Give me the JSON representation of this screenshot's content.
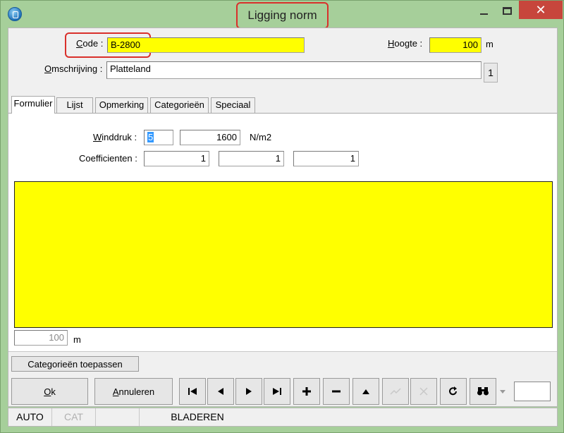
{
  "window": {
    "title": "Ligging norm",
    "close_glyph": "✕"
  },
  "form": {
    "code_label": "ode :",
    "code_label_mnemonic": "C",
    "code_value": "B-2800",
    "hoogte_label": "oogte :",
    "hoogte_label_mnemonic": "H",
    "hoogte_value": "100",
    "hoogte_unit": "m",
    "omschrijving_label": "mschrijving :",
    "omschrijving_label_mnemonic": "O",
    "omschrijving_value": "Platteland",
    "omschrijving_counter": "1"
  },
  "tabs": [
    {
      "label": "Formulier",
      "active": true
    },
    {
      "label": "Lijst",
      "active": false
    },
    {
      "label": "Opmerking",
      "active": false
    },
    {
      "label": "Categorieën",
      "active": false
    },
    {
      "label": "Speciaal",
      "active": false
    }
  ],
  "formulier": {
    "winddruk_label": "inddruk :",
    "winddruk_mnemonic": "W",
    "winddruk_code": "5",
    "winddruk_value": "1600",
    "winddruk_unit": "N/m2",
    "coeff_label": "Coefficienten :",
    "coeff_values": [
      "1",
      "1",
      "1"
    ],
    "bottom_value": "100",
    "bottom_unit": "m"
  },
  "actions": {
    "apply_categories": "Categorieën toepassen",
    "ok_mnemonic": "O",
    "ok_label": "k",
    "cancel_mnemonic": "A",
    "cancel_label": "nnuleren"
  },
  "nav_icons": [
    "first-record-icon",
    "prev-record-icon",
    "next-record-icon",
    "last-record-icon",
    "add-record-icon",
    "delete-record-icon",
    "up-icon",
    "confirm-icon",
    "cancel-edit-icon",
    "refresh-icon",
    "binoculars-icon",
    "dropdown-arrow-icon"
  ],
  "status": {
    "mode1": "AUTO",
    "mode2": "CAT",
    "mode3": "",
    "state": "BLADEREN"
  },
  "colors": {
    "window_frame": "#a6cf9a",
    "required_field": "#ffff00",
    "highlight_outline": "#d9302b",
    "close_button": "#c7463c"
  }
}
